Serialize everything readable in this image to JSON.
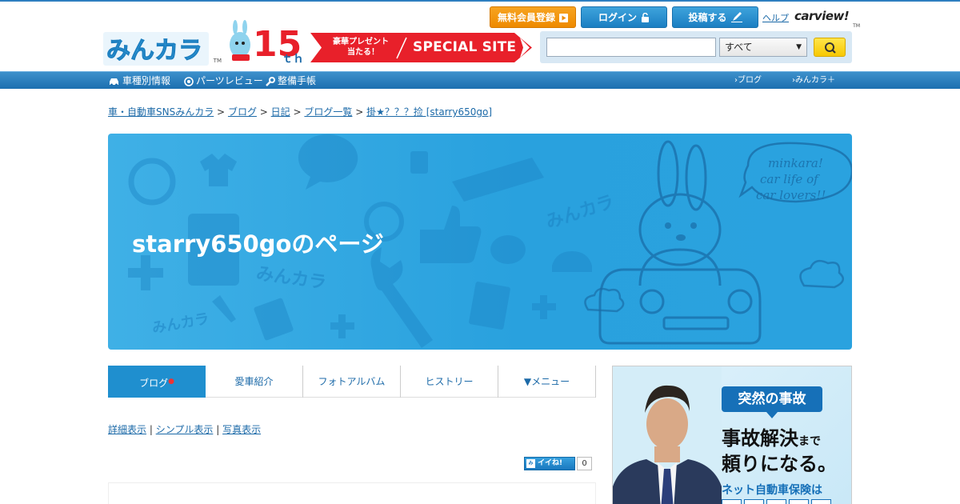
{
  "header": {
    "logo_text": "みんカラ",
    "logo_tm": "TM",
    "anniversary_number": "15",
    "anniversary_suffix": "ｔｈ",
    "special_banner_line1": "豪華プレゼント",
    "special_banner_line2": "当たる！",
    "special_banner_title": "SPECIAL SITE",
    "register_label": "無料会員登録",
    "login_label": "ログイン",
    "post_label": "投稿する",
    "help_label": "ヘルプ",
    "carview_label": "carview!",
    "carview_tm": "TM"
  },
  "search": {
    "value": "",
    "placeholder": "",
    "select_value": "すべて"
  },
  "nav": {
    "left": [
      "車種別情報",
      "パーツレビュー",
      "整備手帳"
    ],
    "right": [
      "ブログ",
      "みんカラ＋"
    ]
  },
  "breadcrumb": {
    "items": [
      "車・自動車SNSみんカラ",
      "ブログ",
      "日記",
      "ブログ一覧",
      "掛★？？？捡 [starry650go]"
    ],
    "separator": ">"
  },
  "hero": {
    "title": "starry650goのページ",
    "bubble_text": [
      "minkara!",
      "car life of",
      "car lovers!!"
    ],
    "stamp_text": "みんカラ"
  },
  "tabs": [
    {
      "label": "ブログ",
      "active": true,
      "dot": "●"
    },
    {
      "label": "愛車紹介",
      "active": false
    },
    {
      "label": "フォトアルバム",
      "active": false
    },
    {
      "label": "ヒストリー",
      "active": false
    },
    {
      "label": "▼メニュー",
      "active": false
    }
  ],
  "view_links": {
    "items": [
      "詳細表示",
      "シンプル表示",
      "写真表示"
    ],
    "separator": "|"
  },
  "iine": {
    "logo": "みんカラ",
    "label": "イイね!",
    "count": "0"
  },
  "ad": {
    "badge": "突然の事故",
    "line1_main": "事故解決",
    "line1_small": "まで",
    "line2": "頼りになる。",
    "line3": "ネット自動車保険は"
  },
  "colors": {
    "brand_blue": "#1f8fcf",
    "nav_blue": "#1c6fb0",
    "register_orange": "#ee8a00",
    "link_blue": "#1c6aa8",
    "search_button_yellow": "#f7c800",
    "special_banner_red": "#e8202a"
  }
}
